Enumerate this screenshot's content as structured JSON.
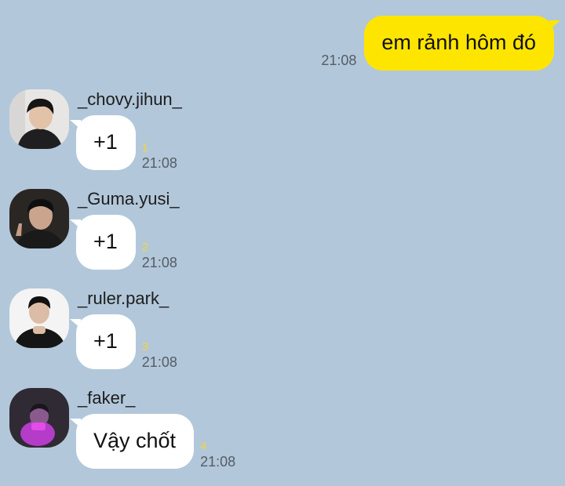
{
  "outgoing": {
    "text": "em rảnh hôm đó",
    "time": "21:08"
  },
  "messages": [
    {
      "sender": "_chovy.jihun_",
      "text": "+1",
      "unread": "1",
      "time": "21:08",
      "avatar_icon": "profile-photo"
    },
    {
      "sender": "_Guma.yusi_",
      "text": "+1",
      "unread": "2",
      "time": "21:08",
      "avatar_icon": "profile-photo"
    },
    {
      "sender": "_ruler.park_",
      "text": "+1",
      "unread": "3",
      "time": "21:08",
      "avatar_icon": "profile-photo"
    },
    {
      "sender": "_faker_",
      "text": "Vậy chốt",
      "unread": "4",
      "time": "21:08",
      "avatar_icon": "profile-photo"
    }
  ],
  "colors": {
    "background": "#b2c7da",
    "outgoing_bubble": "#fee500",
    "incoming_bubble": "#ffffff",
    "unread_count": "#f4d43b"
  }
}
